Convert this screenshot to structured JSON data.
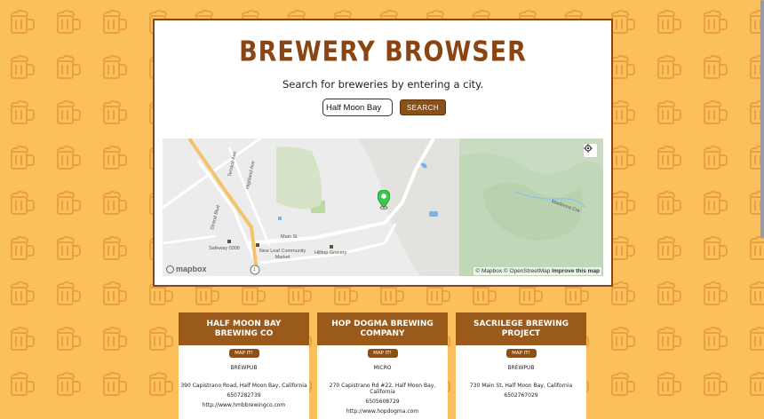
{
  "app": {
    "title": "BREWERY BROWSER",
    "subtitle": "Search for breweries by entering a city."
  },
  "search": {
    "value": "Half Moon Bay",
    "button_label": "SEARCH"
  },
  "map": {
    "attribution_1": "© Mapbox © OpenStreetMap",
    "attribution_2": "Improve this map",
    "logo": "mapbox",
    "labels": {
      "terrace": "Terrace Ave",
      "highland": "Highland Ave",
      "strand": "Strand Blvd",
      "main": "Main St",
      "safeway": "Safeway 0308",
      "newleaf": "New Leaf Community Market",
      "hilltop": "Hilltop Grocery",
      "creek": "Madonna Cre",
      "route": "1"
    },
    "locate_icon": "crosshair-icon",
    "marker_icon": "map-pin-icon"
  },
  "breweries": [
    {
      "name": "HALF MOON BAY BREWING CO",
      "button": "MAP IT!",
      "type": "BREWPUB",
      "address": "390 Capistrano Road, Half Moon Bay, California",
      "phone": "6507282739",
      "url": "http://www.hmbbrewingco.com"
    },
    {
      "name": "HOP DOGMA BREWING COMPANY",
      "button": "MAP IT!",
      "type": "MICRO",
      "address": "270 Capistrano Rd #22, Half Moon Bay, California",
      "phone": "6505608729",
      "url": "http://www.hopdogma.com"
    },
    {
      "name": "SACRILEGE BREWING PROJECT",
      "button": "MAP IT!",
      "type": "BREWPUB",
      "address": "730 Main St, Half Moon Bay, California",
      "phone": "6502767029",
      "url": ""
    }
  ],
  "colors": {
    "background": "#fbbf5c",
    "brand_brown": "#8b4513",
    "card_header": "#9a5a1c",
    "marker_green": "#3cc84a"
  }
}
